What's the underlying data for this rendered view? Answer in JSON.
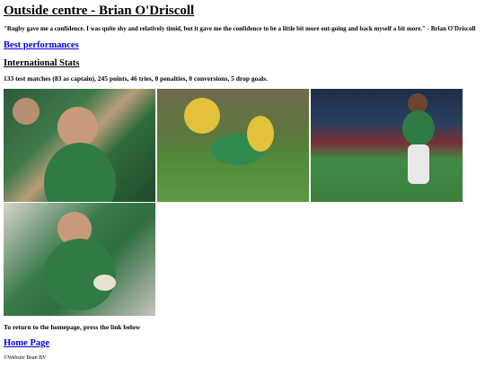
{
  "title": "Outside centre - Brian O'Driscoll",
  "quote": "\"Rugby gave me a confidence. I was quite shy and relatively timid, but it gave me the confidence to be a little bit more out-going and back myself a bit more.\" - Brian O'Driscoll",
  "best_performances_link": "Best performances",
  "stats_heading": "International Stats",
  "stats_text": "133 test matches (83 as captain), 245 points, 46 tries, 0 penalties, 0 conversions, 5 drop goals.",
  "return_text": "To return to the homepage, press the link below",
  "home_link": "Home Page",
  "footer_text": "©Website Bean BV"
}
